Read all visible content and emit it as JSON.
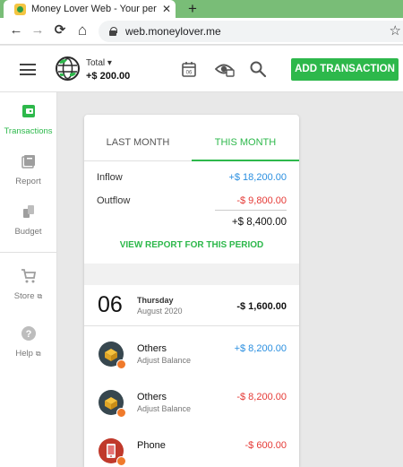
{
  "browser": {
    "tab_title": "Money Lover Web - Your persona",
    "tab_close": "✕",
    "new_tab": "+",
    "back": "←",
    "forward": "→",
    "reload": "⟳",
    "home": "⌂",
    "url": "web.moneylover.me",
    "star": "☆"
  },
  "header": {
    "total_label": "Total ▾",
    "total_amount": "+$ 200.00",
    "calendar_day": "06",
    "add_button": "ADD TRANSACTION"
  },
  "sidebar": {
    "items": [
      {
        "label": "Transactions",
        "icon": "wallet-icon",
        "active": true
      },
      {
        "label": "Report",
        "icon": "report-icon",
        "active": false
      },
      {
        "label": "Budget",
        "icon": "budget-icon",
        "active": false
      },
      {
        "label": "Store",
        "icon": "cart-icon",
        "active": false
      },
      {
        "label": "Help",
        "icon": "help-icon",
        "active": false
      }
    ]
  },
  "period_tabs": {
    "last": "LAST MONTH",
    "this": "THIS MONTH"
  },
  "summary": {
    "inflow_label": "Inflow",
    "inflow_value": "+$ 18,200.00",
    "outflow_label": "Outflow",
    "outflow_value": "-$ 9,800.00",
    "net_value": "+$ 8,400.00",
    "view_report": "VIEW REPORT FOR THIS PERIOD"
  },
  "day": {
    "number": "06",
    "weekday": "Thursday",
    "month_year": "August 2020",
    "total": "-$ 1,600.00"
  },
  "transactions": [
    {
      "category": "Others",
      "note": "Adjust Balance",
      "amount": "+$ 8,200.00",
      "type": "income"
    },
    {
      "category": "Others",
      "note": "Adjust Balance",
      "amount": "-$ 8,200.00",
      "type": "expense"
    },
    {
      "category": "Phone",
      "note": "",
      "amount": "-$ 600.00",
      "type": "expense"
    }
  ],
  "colors": {
    "brand_green": "#2db84b",
    "inflow_blue": "#2a8fe0",
    "outflow_red": "#e53935"
  }
}
